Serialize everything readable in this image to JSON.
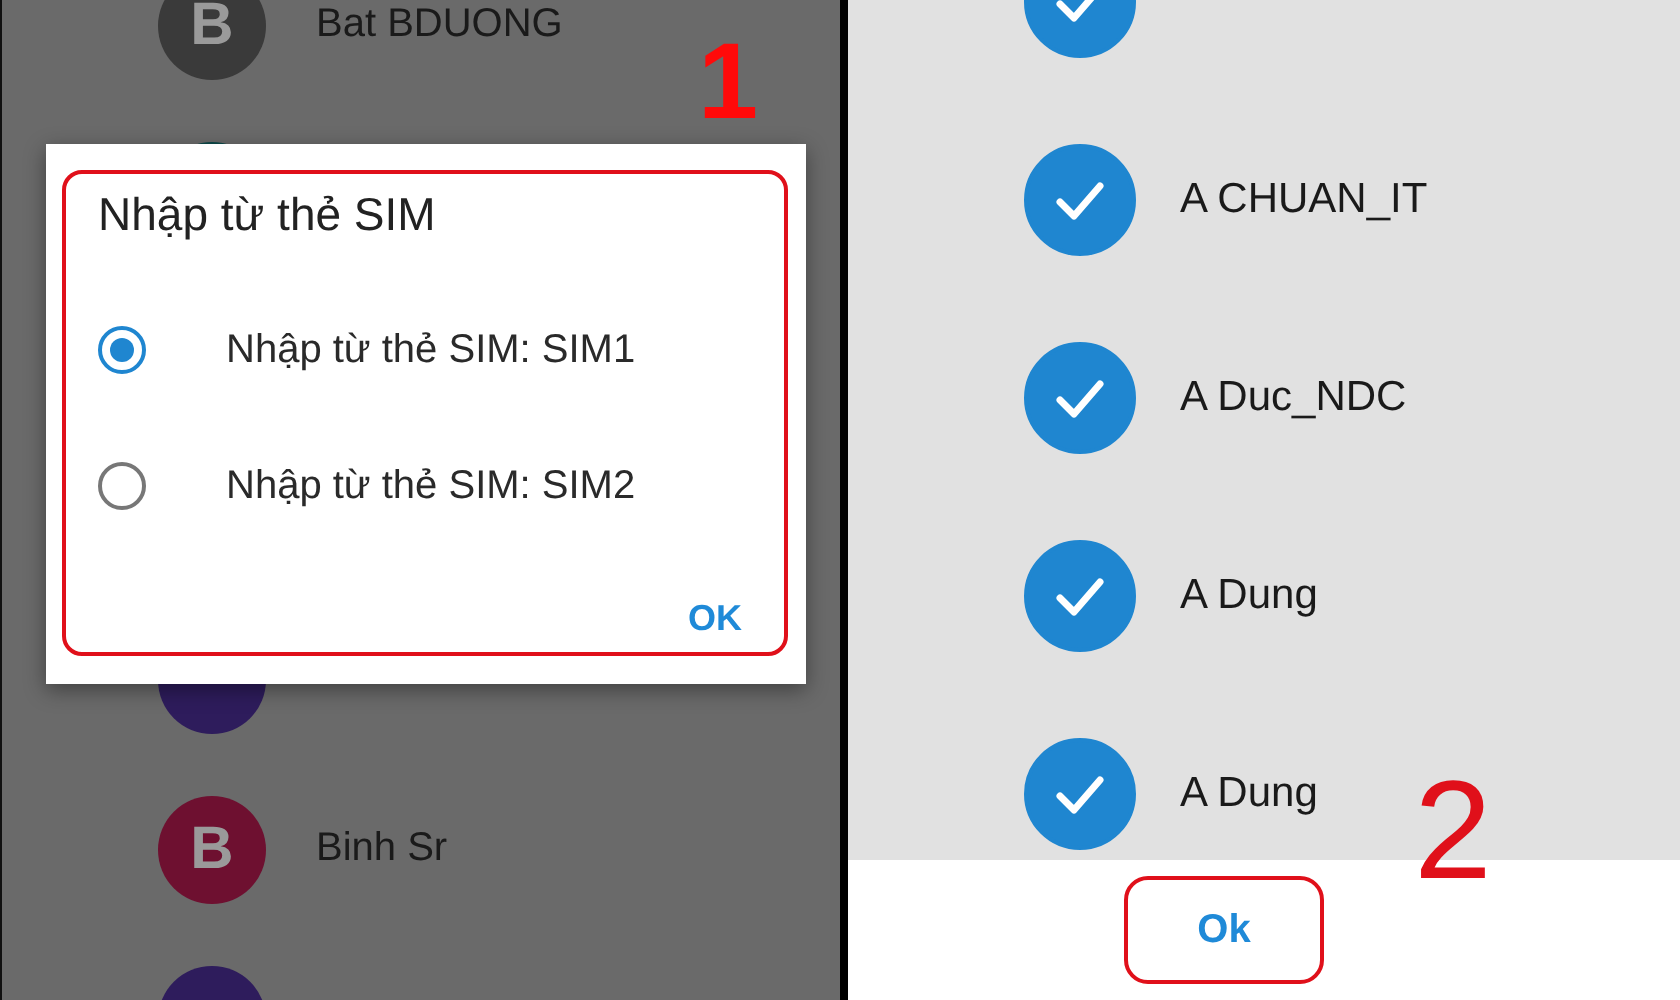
{
  "left_screen": {
    "contacts_top": [
      {
        "initial": "B",
        "name": "Bat BDUONG",
        "color": "#3a3a3a"
      },
      {
        "color": "#0e4a4a"
      }
    ],
    "dialog": {
      "title": "Nhập từ thẻ SIM",
      "options": [
        {
          "label": "Nhập từ thẻ SIM: SIM1",
          "selected": true
        },
        {
          "label": "Nhập từ thẻ SIM: SIM2",
          "selected": false
        }
      ],
      "ok": "OK"
    },
    "contacts_bottom": [
      {
        "color": "#2e1c5c"
      },
      {
        "initial": "B",
        "name": "Binh Sr",
        "color": "#6e1030"
      },
      {
        "color": "#2e1c5c"
      }
    ],
    "step_number": "1"
  },
  "right_screen": {
    "contacts": [
      {
        "checked": true
      },
      {
        "name": "A CHUAN_IT",
        "checked": true
      },
      {
        "name": "A Duc_NDC",
        "checked": true
      },
      {
        "name": "A Dung",
        "checked": true
      },
      {
        "name": "A Dung",
        "checked": true
      }
    ],
    "ok_button": "Ok",
    "step_number": "2"
  }
}
